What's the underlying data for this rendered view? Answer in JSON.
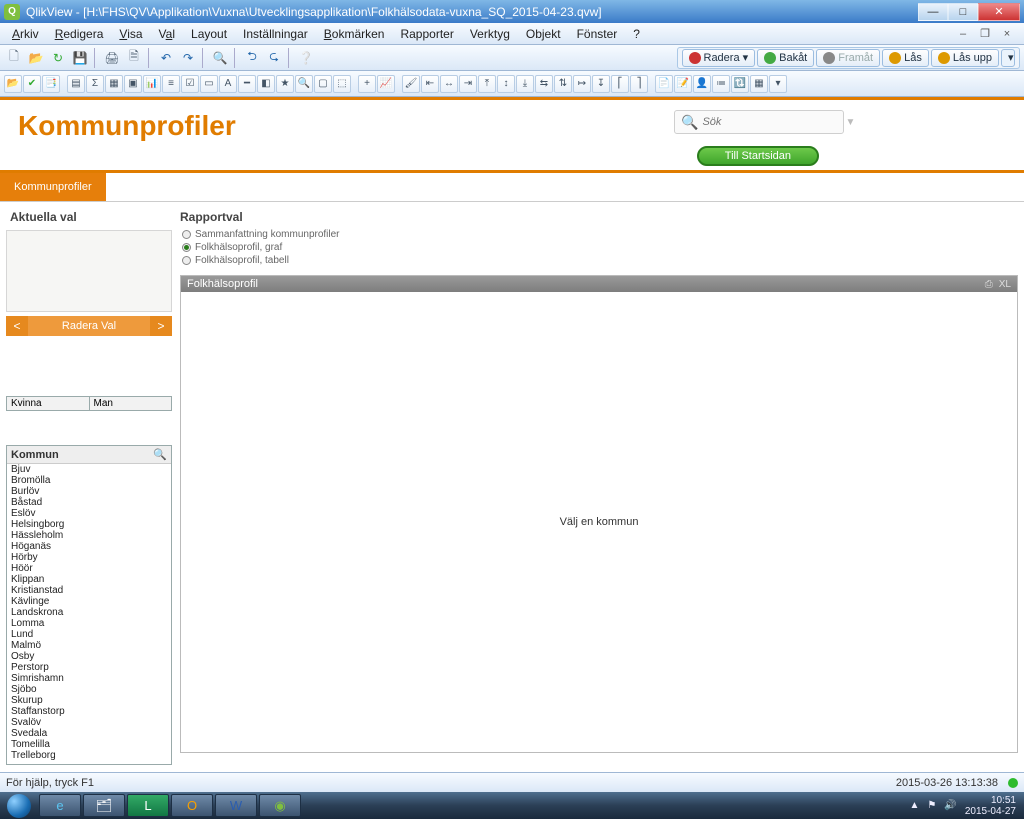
{
  "window": {
    "app": "QlikView",
    "path": "[H:\\FHS\\QV\\Applikation\\Vuxna\\Utvecklingsapplikation\\Folkhälsodata-vuxna_SQ_2015-04-23.qvw]"
  },
  "menu": {
    "arkiv": "Arkiv",
    "redigera": "Redigera",
    "visa": "Visa",
    "val": "Val",
    "layout": "Layout",
    "installningar": "Inställningar",
    "bokmarken": "Bokmärken",
    "rapporter": "Rapporter",
    "verktyg": "Verktyg",
    "objekt": "Objekt",
    "fonster": "Fönster",
    "help": "?"
  },
  "right_toolbar": {
    "radera": "Radera",
    "bakat": "Bakåt",
    "framat": "Framåt",
    "las": "Lås",
    "las_upp": "Lås upp"
  },
  "page": {
    "title": "Kommunprofiler",
    "search_placeholder": "Sök",
    "startsidan": "Till Startsidan",
    "tab": "Kommunprofiler"
  },
  "left": {
    "aktuella_title": "Aktuella val",
    "radera_val": "Radera Val",
    "lt": "<",
    "gt": ">",
    "kvinna": "Kvinna",
    "man": "Man",
    "kommun_hdr": "Kommun",
    "kommuner": [
      "Bjuv",
      "Bromölla",
      "Burlöv",
      "Båstad",
      "Eslöv",
      "Helsingborg",
      "Hässleholm",
      "Höganäs",
      "Hörby",
      "Höör",
      "Klippan",
      "Kristianstad",
      "Kävlinge",
      "Landskrona",
      "Lomma",
      "Lund",
      "Malmö",
      "Osby",
      "Perstorp",
      "Simrishamn",
      "Sjöbo",
      "Skurup",
      "Staffanstorp",
      "Svalöv",
      "Svedala",
      "Tomelilla",
      "Trelleborg"
    ]
  },
  "right": {
    "rapportval_title": "Rapportval",
    "rv": [
      {
        "label": "Sammanfattning kommunprofiler",
        "selected": false
      },
      {
        "label": "Folkhälsoprofil, graf",
        "selected": true
      },
      {
        "label": "Folkhälsoprofil, tabell",
        "selected": false
      }
    ],
    "chart_title": "Folkhälsoprofil",
    "chart_tools_print": "⎙",
    "chart_tools_xl": "XL",
    "chart_empty": "Välj en kommun"
  },
  "status": {
    "help": "För hjälp, tryck F1",
    "timestamp": "2015-03-26 13:13:38"
  },
  "tray": {
    "time": "10:51",
    "date": "2015-04-27"
  }
}
